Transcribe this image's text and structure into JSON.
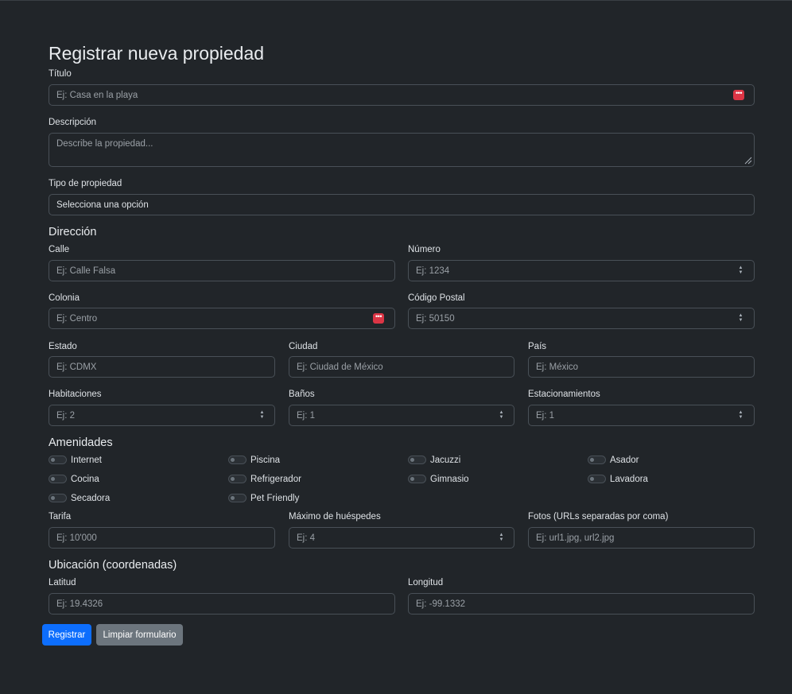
{
  "page_title": "Registrar nueva propiedad",
  "titulo": {
    "label": "Título",
    "placeholder": "Ej: Casa en la playa"
  },
  "descripcion": {
    "label": "Descripción",
    "placeholder": "Describe la propiedad..."
  },
  "tipo": {
    "label": "Tipo de propiedad",
    "selected": "Selecciona una opción"
  },
  "direccion": {
    "heading": "Dirección",
    "calle": {
      "label": "Calle",
      "placeholder": "Ej: Calle Falsa"
    },
    "numero": {
      "label": "Número",
      "placeholder": "Ej: 1234"
    },
    "colonia": {
      "label": "Colonia",
      "placeholder": "Ej: Centro"
    },
    "cp": {
      "label": "Código Postal",
      "placeholder": "Ej: 50150"
    },
    "estado": {
      "label": "Estado",
      "placeholder": "Ej: CDMX"
    },
    "ciudad": {
      "label": "Ciudad",
      "placeholder": "Ej: Ciudad de México"
    },
    "pais": {
      "label": "País",
      "placeholder": "Ej: México"
    }
  },
  "habitaciones": {
    "label": "Habitaciones",
    "placeholder": "Ej: 2"
  },
  "banos": {
    "label": "Baños",
    "placeholder": "Ej: 1"
  },
  "estacionamientos": {
    "label": "Estacionamientos",
    "placeholder": "Ej: 1"
  },
  "amenidades": {
    "heading": "Amenidades",
    "items": [
      "Internet",
      "Piscina",
      "Jacuzzi",
      "Asador",
      "Cocina",
      "Refrigerador",
      "Gimnasio",
      "Lavadora",
      "Secadora",
      "Pet Friendly"
    ]
  },
  "tarifa": {
    "label": "Tarifa",
    "placeholder": "Ej: 10'000"
  },
  "huespedes": {
    "label": "Máximo de huéspedes",
    "placeholder": "Ej: 4"
  },
  "fotos": {
    "label": "Fotos (URLs separadas por coma)",
    "placeholder": "Ej: url1.jpg, url2.jpg"
  },
  "ubicacion": {
    "heading": "Ubicación (coordenadas)",
    "latitud": {
      "label": "Latitud",
      "placeholder": "Ej: 19.4326"
    },
    "longitud": {
      "label": "Longitud",
      "placeholder": "Ej: -99.1332"
    }
  },
  "buttons": {
    "submit": "Registrar",
    "reset": "Limpiar formulario"
  },
  "colors": {
    "background": "#212529",
    "primary": "#0d6efd",
    "secondary": "#6c757d",
    "danger": "#dc3545"
  }
}
